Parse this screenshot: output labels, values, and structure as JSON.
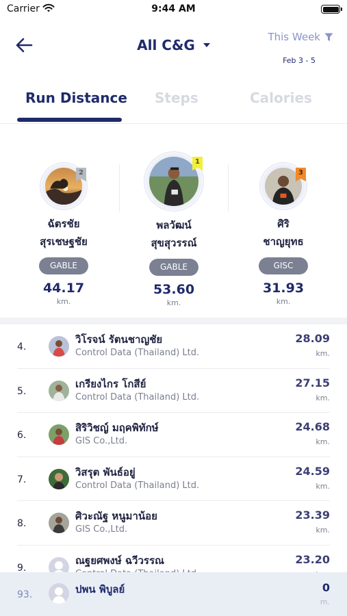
{
  "status_bar": {
    "carrier": "Carrier",
    "time": "9:44 AM"
  },
  "header": {
    "title": "All C&G",
    "filter_label": "This Week",
    "date_range": "Feb 3 - 5"
  },
  "tabs": [
    {
      "label": "Run Distance",
      "active": true
    },
    {
      "label": "Steps",
      "active": false
    },
    {
      "label": "Calories",
      "active": false
    }
  ],
  "podium": [
    {
      "rank": "2",
      "name_line1": "ฉัตรชัย",
      "name_line2": "สุรเชษฐชัย",
      "group": "GABLE",
      "value": "44.17",
      "unit": "km.",
      "badge_color": "#b7b9c0"
    },
    {
      "rank": "1",
      "name_line1": "พลวัฒน์",
      "name_line2": "สุขสุวรรณ์",
      "group": "GABLE",
      "value": "53.60",
      "unit": "km.",
      "badge_color": "#f2ef3a"
    },
    {
      "rank": "3",
      "name_line1": "ศิริ",
      "name_line2": "ชาญยุทธ",
      "group": "GISC",
      "value": "31.93",
      "unit": "km.",
      "badge_color": "#f08a2a"
    }
  ],
  "leaderboard": [
    {
      "rank": "4.",
      "name": "วิโรจน์ รัตนชาญชัย",
      "company": "Control Data (Thailand) Ltd.",
      "value": "28.09",
      "unit": "km."
    },
    {
      "rank": "5.",
      "name": "เกรียงไกร โกสีย์",
      "company": "Control Data (Thailand) Ltd.",
      "value": "27.15",
      "unit": "km."
    },
    {
      "rank": "6.",
      "name": "สิริวิชญ์ มฤคพิทักษ์",
      "company": "GIS Co.,Ltd.",
      "value": "24.68",
      "unit": "km."
    },
    {
      "rank": "7.",
      "name": "วิสรุต พันธ์อยู่",
      "company": "Control Data (Thailand) Ltd.",
      "value": "24.59",
      "unit": "km."
    },
    {
      "rank": "8.",
      "name": "ศิวะณัฐ หนูมาน้อย",
      "company": "GIS Co.,Ltd.",
      "value": "23.39",
      "unit": "km."
    },
    {
      "rank": "9.",
      "name": "ณฐยศพงษ์ ฉวีวรรณ",
      "company": "Control Data (Thailand) Ltd.",
      "value": "23.20",
      "unit": "km."
    }
  ],
  "current_user": {
    "rank": "93.",
    "name": "ปพน พิบูลย์",
    "value": "0",
    "unit": "m."
  },
  "icons": {
    "back": "arrow-left-icon",
    "dropdown": "caret-down-icon",
    "filter": "funnel-icon",
    "wifi": "wifi-icon",
    "battery": "battery-icon"
  },
  "colors": {
    "primary": "#1f2a6b",
    "accent_light": "#8b94c8",
    "pill": "#7b8092",
    "me_row_bg": "#e9eef5"
  }
}
